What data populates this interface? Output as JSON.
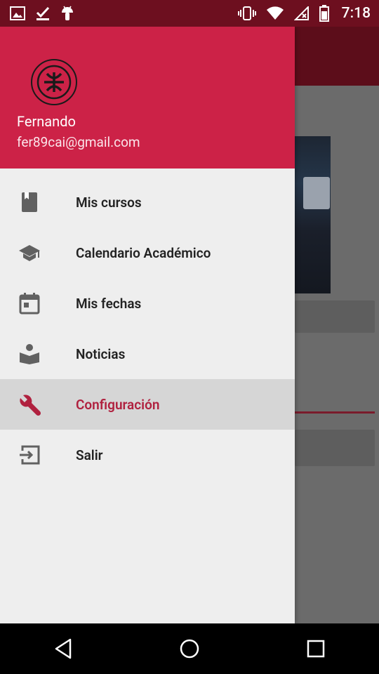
{
  "status_bar": {
    "time": "7:18",
    "left_icons": [
      "image-icon",
      "check-download-icon",
      "android-icon"
    ],
    "right_icons": [
      "vibrate-icon",
      "wifi-icon",
      "no-signal-icon",
      "battery-icon"
    ]
  },
  "drawer": {
    "header": {
      "user_name": "Fernando",
      "user_email": "fer89cai@gmail.com",
      "logo_icon": "utn-logo-icon",
      "background_color": "#cc2247"
    },
    "items": [
      {
        "label": "Mis cursos",
        "icon": "book-icon",
        "active": false
      },
      {
        "label": "Calendario Académico",
        "icon": "school-icon",
        "active": false
      },
      {
        "label": "Mis fechas",
        "icon": "calendar-icon",
        "active": false
      },
      {
        "label": "Noticias",
        "icon": "reading-icon",
        "active": false
      },
      {
        "label": "Configuración",
        "icon": "wrench-icon",
        "active": true
      },
      {
        "label": "Salir",
        "icon": "exit-icon",
        "active": false
      }
    ],
    "active_color": "#b0213f"
  },
  "navigation_bar": {
    "buttons": [
      "back-icon",
      "home-icon",
      "recents-icon"
    ]
  }
}
